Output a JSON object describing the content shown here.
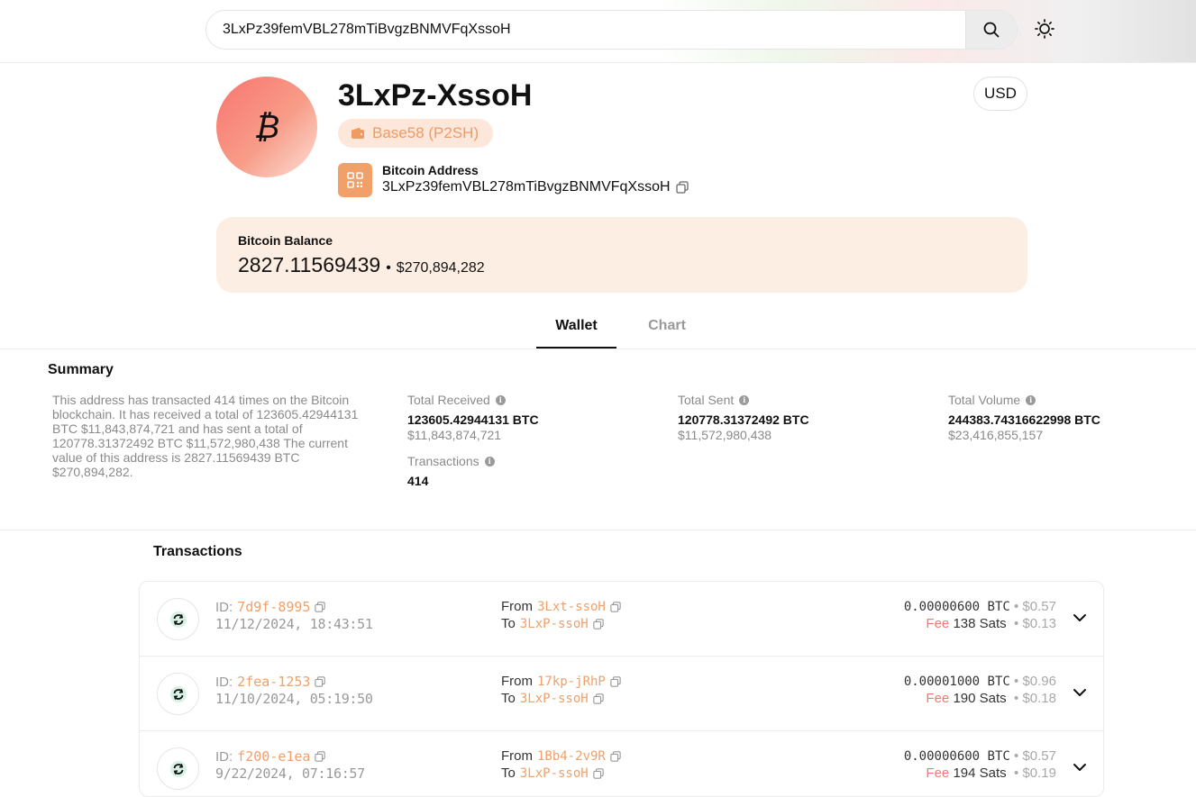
{
  "search": {
    "value": "3LxPz39femVBL278mTiBvgzBNMVFqXssoH"
  },
  "header": {
    "avatar_symbol": "₿",
    "short_address": "3LxPz-XssoH",
    "address_type": "Base58 (P2SH)",
    "currency_button": "USD",
    "address_label": "Bitcoin Address",
    "full_address": "3LxPz39femVBL278mTiBvgzBNMVFqXssoH"
  },
  "balance": {
    "label": "Bitcoin Balance",
    "btc": "2827.11569439",
    "separator": "•",
    "usd": "$270,894,282"
  },
  "tabs": [
    {
      "label": "Wallet",
      "active": true
    },
    {
      "label": "Chart",
      "active": false
    }
  ],
  "summary": {
    "title": "Summary",
    "description": "This address has transacted 414 times on the Bitcoin blockchain. It has received a total of 123605.42944131 BTC $11,843,874,721 and has sent a total of 120778.31372492 BTC $11,572,980,438 The current value of this address is 2827.11569439 BTC $270,894,282.",
    "total_received": {
      "label": "Total Received",
      "btc": "123605.42944131 BTC",
      "usd": "$11,843,874,721"
    },
    "total_sent": {
      "label": "Total Sent",
      "btc": "120778.31372492 BTC",
      "usd": "$11,572,980,438"
    },
    "total_volume": {
      "label": "Total Volume",
      "btc": "244383.74316622998 BTC",
      "usd": "$23,416,855,157"
    },
    "transactions": {
      "label": "Transactions",
      "value": "414"
    }
  },
  "transactions": {
    "title": "Transactions",
    "id_label": "ID:",
    "from_label": "From",
    "to_label": "To",
    "fee_label": "Fee",
    "bullet": "•",
    "rows": [
      {
        "id": "7d9f-8995",
        "date": "11/12/2024, 18:43:51",
        "from": "3Lxt-ssoH",
        "to": "3LxP-ssoH",
        "amount": "0.00000600 BTC",
        "amount_usd": "$0.57",
        "fee": "138 Sats",
        "fee_usd": "$0.13"
      },
      {
        "id": "2fea-1253",
        "date": "11/10/2024, 05:19:50",
        "from": "17kp-jRhP",
        "to": "3LxP-ssoH",
        "amount": "0.00001000 BTC",
        "amount_usd": "$0.96",
        "fee": "190 Sats",
        "fee_usd": "$0.18"
      },
      {
        "id": "f200-e1ea",
        "date": "9/22/2024, 07:16:57",
        "from": "1Bb4-2v9R",
        "to": "3LxP-ssoH",
        "amount": "0.00000600 BTC",
        "amount_usd": "$0.57",
        "fee": "194 Sats",
        "fee_usd": "$0.19"
      }
    ]
  },
  "icons": {
    "search": "search-icon",
    "theme": "sun-icon",
    "wallet": "wallet-icon",
    "qr": "qr-code-icon",
    "copy": "copy-icon",
    "info": "info-icon",
    "tx": "refresh-icon",
    "expand": "chevron-down-icon"
  },
  "colors": {
    "accent": "#f0a068",
    "fee": "#f07a72",
    "tx_icon": "#2bb37b",
    "balance_bg": "#fdeee3"
  }
}
